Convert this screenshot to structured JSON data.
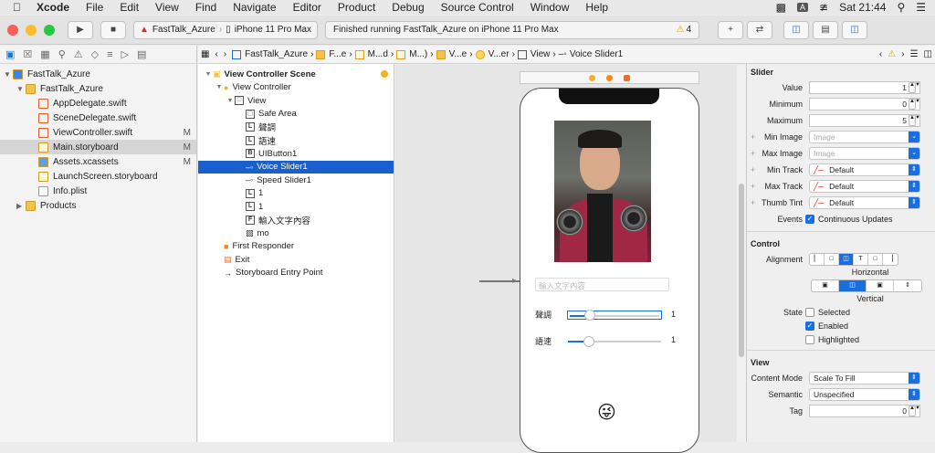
{
  "menubar": {
    "app": "Xcode",
    "items": [
      "File",
      "Edit",
      "View",
      "Find",
      "Navigate",
      "Editor",
      "Product",
      "Debug",
      "Source Control",
      "Window",
      "Help"
    ],
    "clock": "Sat 21:44",
    "input_badge": "A"
  },
  "toolbar": {
    "scheme": "FastTalk_Azure",
    "device": "iPhone 11 Pro Max",
    "status": "Finished running FastTalk_Azure on iPhone 11 Pro Max",
    "warning_count": "4"
  },
  "navigator": {
    "items": [
      {
        "label": "FastTalk_Azure",
        "indent": 0,
        "icon": "project",
        "expanded": true
      },
      {
        "label": "FastTalk_Azure",
        "indent": 1,
        "icon": "folder",
        "expanded": true
      },
      {
        "label": "AppDelegate.swift",
        "indent": 2,
        "icon": "swift"
      },
      {
        "label": "SceneDelegate.swift",
        "indent": 2,
        "icon": "swift"
      },
      {
        "label": "ViewController.swift",
        "indent": 2,
        "icon": "swift",
        "mark": "M"
      },
      {
        "label": "Main.storyboard",
        "indent": 2,
        "icon": "storyboard",
        "mark": "M",
        "selected": true
      },
      {
        "label": "Assets.xcassets",
        "indent": 2,
        "icon": "assets",
        "mark": "M"
      },
      {
        "label": "LaunchScreen.storyboard",
        "indent": 2,
        "icon": "storyboard"
      },
      {
        "label": "Info.plist",
        "indent": 2,
        "icon": "plist"
      },
      {
        "label": "Products",
        "indent": 1,
        "icon": "folder",
        "collapsed": true
      }
    ]
  },
  "jumpbar": {
    "segments": [
      "FastTalk_Azure",
      "F...e",
      "M...d",
      "M...)",
      "V...e",
      "V...er",
      "View",
      "Voice Slider1"
    ]
  },
  "outline": {
    "rows": [
      {
        "label": "View Controller Scene",
        "indent": 0,
        "icon": "scene",
        "expanded": true
      },
      {
        "label": "View Controller",
        "indent": 1,
        "icon": "vc",
        "expanded": true
      },
      {
        "label": "View",
        "indent": 2,
        "icon": "view",
        "expanded": true
      },
      {
        "label": "Safe Area",
        "indent": 3,
        "icon": "safe"
      },
      {
        "label": "聲調",
        "indent": 3,
        "icon": "L"
      },
      {
        "label": "語速",
        "indent": 3,
        "icon": "L"
      },
      {
        "label": "UIButton1",
        "indent": 3,
        "icon": "B"
      },
      {
        "label": "Voice Slider1",
        "indent": 3,
        "icon": "slider",
        "selected": true
      },
      {
        "label": "Speed Slider1",
        "indent": 3,
        "icon": "slider"
      },
      {
        "label": "1",
        "indent": 3,
        "icon": "L"
      },
      {
        "label": "1",
        "indent": 3,
        "icon": "L"
      },
      {
        "label": "輸入文字內容",
        "indent": 3,
        "icon": "F"
      },
      {
        "label": "mo",
        "indent": 3,
        "icon": "img"
      },
      {
        "label": "First Responder",
        "indent": 1,
        "icon": "responder"
      },
      {
        "label": "Exit",
        "indent": 1,
        "icon": "exit"
      },
      {
        "label": "Storyboard Entry Point",
        "indent": 1,
        "icon": "arrow"
      }
    ]
  },
  "canvas": {
    "textfield_placeholder": "輸入文字內容",
    "pitch_label": "聲調",
    "pitch_value": "1",
    "speed_label": "語速",
    "speed_value": "1",
    "emoji": "😜"
  },
  "inspector": {
    "slider_section": "Slider",
    "value_label": "Value",
    "value": "1",
    "minimum_label": "Minimum",
    "minimum": "0",
    "maximum_label": "Maximum",
    "maximum": "5",
    "min_image_label": "Min Image",
    "min_image_placeholder": "Image",
    "max_image_label": "Max Image",
    "max_image_placeholder": "Image",
    "min_track_label": "Min Track",
    "min_track": "Default",
    "max_track_label": "Max Track",
    "max_track": "Default",
    "thumb_tint_label": "Thumb Tint",
    "thumb_tint": "Default",
    "events_label": "Events",
    "continuous_updates": "Continuous Updates",
    "control_section": "Control",
    "alignment_label": "Alignment",
    "horizontal": "Horizontal",
    "vertical": "Vertical",
    "state_label": "State",
    "selected": "Selected",
    "enabled": "Enabled",
    "highlighted": "Highlighted",
    "view_section": "View",
    "content_mode_label": "Content Mode",
    "content_mode": "Scale To Fill",
    "semantic_label": "Semantic",
    "semantic": "Unspecified",
    "tag_label": "Tag",
    "tag": "0"
  },
  "colors": {
    "accent": "#1a6fe0",
    "selection": "#1a5fd0"
  }
}
